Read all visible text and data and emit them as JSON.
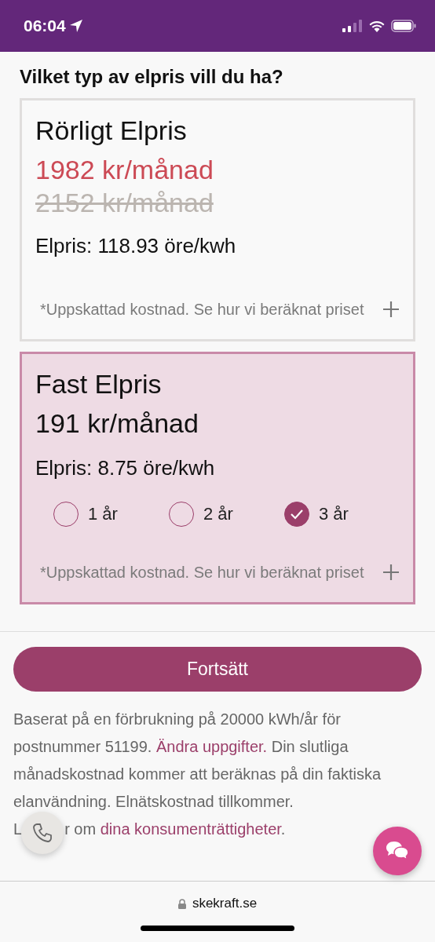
{
  "status_bar": {
    "time": "06:04"
  },
  "heading": "Vilket typ av elpris vill du ha?",
  "price_options": [
    {
      "title": "Rörligt Elpris",
      "selected": false,
      "price": "1982 kr/månad",
      "discounted": true,
      "old_price": "2152 kr/månad",
      "rate": "Elpris: 118.93 öre/kwh",
      "note": "*Uppskattad kostnad. Se hur vi beräknat priset",
      "expanded": false
    },
    {
      "title": "Fast Elpris",
      "selected": true,
      "price": "191 kr/månad",
      "discounted": false,
      "rate": "Elpris: 8.75 öre/kwh",
      "terms": [
        {
          "label": "1 år",
          "selected": false
        },
        {
          "label": "2 år",
          "selected": false
        },
        {
          "label": "3 år",
          "selected": true
        }
      ],
      "note": "*Uppskattad kostnad. Se hur vi beräknat priset",
      "expanded": false
    }
  ],
  "continue_button": "Fortsätt",
  "info": {
    "text": "Baserat på en förbrukning på 20000 kWh/år för postnummer 51199. ",
    "link": "Ändra uppgifter.",
    "text_after": " Din slutliga månadskostnad kommer att beräknas på din faktiska elanvändning. Elnätskostnad tillkommer.",
    "rights_text": "L",
    "rights_text_2": "r om ",
    "rights_link": "dina konsumenträttigheter",
    "rights_end": "."
  },
  "browser": {
    "url": "skekraft.se"
  }
}
